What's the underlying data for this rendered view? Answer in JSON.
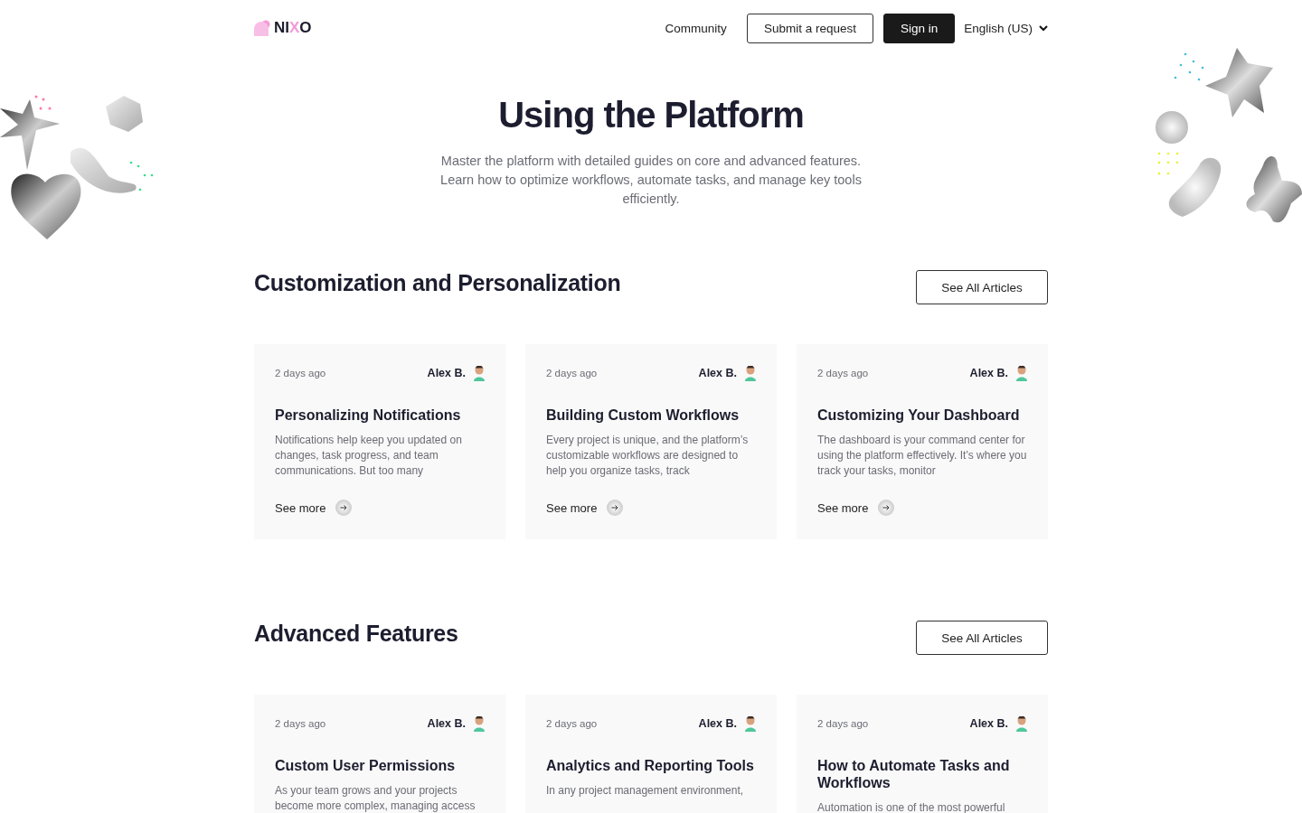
{
  "header": {
    "logo": [
      {
        "text": "NI",
        "accent": false
      },
      {
        "text": "X",
        "accent": true
      },
      {
        "text": "O",
        "accent": false
      }
    ],
    "nav": [
      {
        "label": "Community",
        "kind": "link"
      },
      {
        "label": "Submit a request",
        "kind": "outline"
      },
      {
        "label": "Sign in",
        "kind": "solid"
      },
      {
        "label": "English (US)",
        "kind": "dropdown"
      }
    ]
  },
  "hero": {
    "title": "Using the Platform",
    "subtitle": "Master the platform with detailed guides on core and advanced features. Learn how to optimize workflows, automate tasks, and manage key tools efficiently."
  },
  "sections": [
    {
      "title": "Customization and Personalization",
      "button": "See All Articles",
      "articles": [
        {
          "time": "2 days ago",
          "author": "Alex B.",
          "title": "Personalizing Notifications",
          "excerpt": "Notifications help keep you updated on changes, task progress, and team communications. But too many",
          "link": "See more"
        },
        {
          "time": "2 days ago",
          "author": "Alex B.",
          "title": "Building Custom Workflows",
          "excerpt": "Every project is unique, and the platform’s customizable workflows are designed to help you organize tasks, track",
          "link": "See more"
        },
        {
          "time": "2 days ago",
          "author": "Alex B.",
          "title": "Customizing Your Dashboard",
          "excerpt": "The dashboard is your command center for using the platform effectively. It’s where you track your tasks, monitor",
          "link": "See more"
        }
      ]
    },
    {
      "title": "Advanced Features",
      "button": "See All Articles",
      "articles": [
        {
          "time": "2 days ago",
          "author": "Alex B.",
          "title": "Custom User Permissions",
          "excerpt": "As your team grows and your projects become more complex, managing access"
        },
        {
          "time": "2 days ago",
          "author": "Alex B.",
          "title": "Analytics and Reporting Tools",
          "excerpt": "In any project management environment,"
        },
        {
          "time": "2 days ago",
          "author": "Alex B.",
          "title": "How to Automate Tasks and Workflows",
          "excerpt": "Automation is one of the most powerful"
        }
      ]
    }
  ]
}
